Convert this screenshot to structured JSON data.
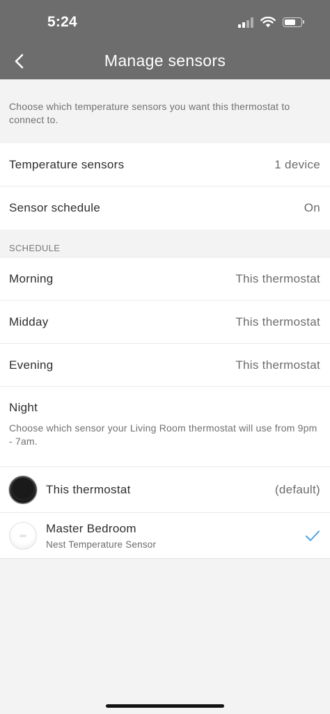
{
  "status_bar": {
    "time": "5:24",
    "icons": [
      "cellular-signal-icon",
      "wifi-icon",
      "battery-icon"
    ]
  },
  "header": {
    "title": "Manage sensors",
    "back_icon": "chevron-left-icon",
    "background_color": "#6d6d6d"
  },
  "intro_text": "Choose which temperature sensors you want this thermostat to connect to.",
  "settings": [
    {
      "label": "Temperature sensors",
      "value": "1 device"
    },
    {
      "label": "Sensor schedule",
      "value": "On"
    }
  ],
  "schedule": {
    "section_label": "SCHEDULE",
    "periods": [
      {
        "label": "Morning",
        "value": "This thermostat"
      },
      {
        "label": "Midday",
        "value": "This thermostat"
      },
      {
        "label": "Evening",
        "value": "This thermostat"
      }
    ],
    "night": {
      "label": "Night",
      "description": "Choose which sensor your Living Room thermostat will use from 9pm - 7am."
    }
  },
  "devices": [
    {
      "name": "This thermostat",
      "subtitle": "",
      "tag": "(default)",
      "icon": "thermostat-icon",
      "selected": false
    },
    {
      "name": "Master Bedroom",
      "subtitle": "Nest Temperature Sensor",
      "tag": "",
      "icon": "temperature-sensor-icon",
      "selected": true
    }
  ],
  "colors": {
    "accent": "#4aa3df",
    "page_background": "#f3f3f3"
  }
}
